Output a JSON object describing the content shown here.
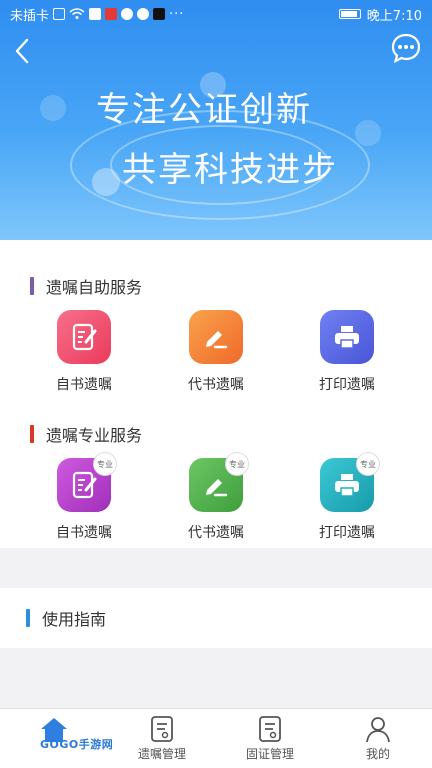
{
  "status_bar": {
    "left_text": "未插卡",
    "more": "···",
    "time": "晚上7:10"
  },
  "header": {
    "hero_line1": "专注公证创新",
    "hero_line2": "共享科技进步"
  },
  "self_service": {
    "title": "遗嘱自助服务",
    "bar_color": "#7b5ea7",
    "items": [
      {
        "label": "自书遗嘱",
        "icon": "edit-document-icon",
        "color": "#f0506e"
      },
      {
        "label": "代书遗嘱",
        "icon": "pen-write-icon",
        "color": "#f6883a"
      },
      {
        "label": "打印遗嘱",
        "icon": "printer-icon",
        "color": "#5c6ee6"
      }
    ]
  },
  "pro_service": {
    "title": "遗嘱专业服务",
    "bar_color": "#d23a2a",
    "tag": "专业",
    "items": [
      {
        "label": "自书遗嘱",
        "icon": "edit-document-icon",
        "color": "#b43cc8"
      },
      {
        "label": "代书遗嘱",
        "icon": "pen-write-icon",
        "color": "#4cb04a"
      },
      {
        "label": "打印遗嘱",
        "icon": "printer-icon",
        "color": "#1fb1c0"
      }
    ]
  },
  "guide": {
    "title": "使用指南",
    "bar_color": "#2f8de0"
  },
  "bottom_nav": {
    "items": [
      {
        "label": "",
        "icon": "home-icon",
        "active": true
      },
      {
        "label": "遗嘱管理",
        "icon": "document-list-icon"
      },
      {
        "label": "固证管理",
        "icon": "document-check-icon"
      },
      {
        "label": "我的",
        "icon": "user-icon"
      }
    ]
  },
  "watermark": "GOGO手游网"
}
